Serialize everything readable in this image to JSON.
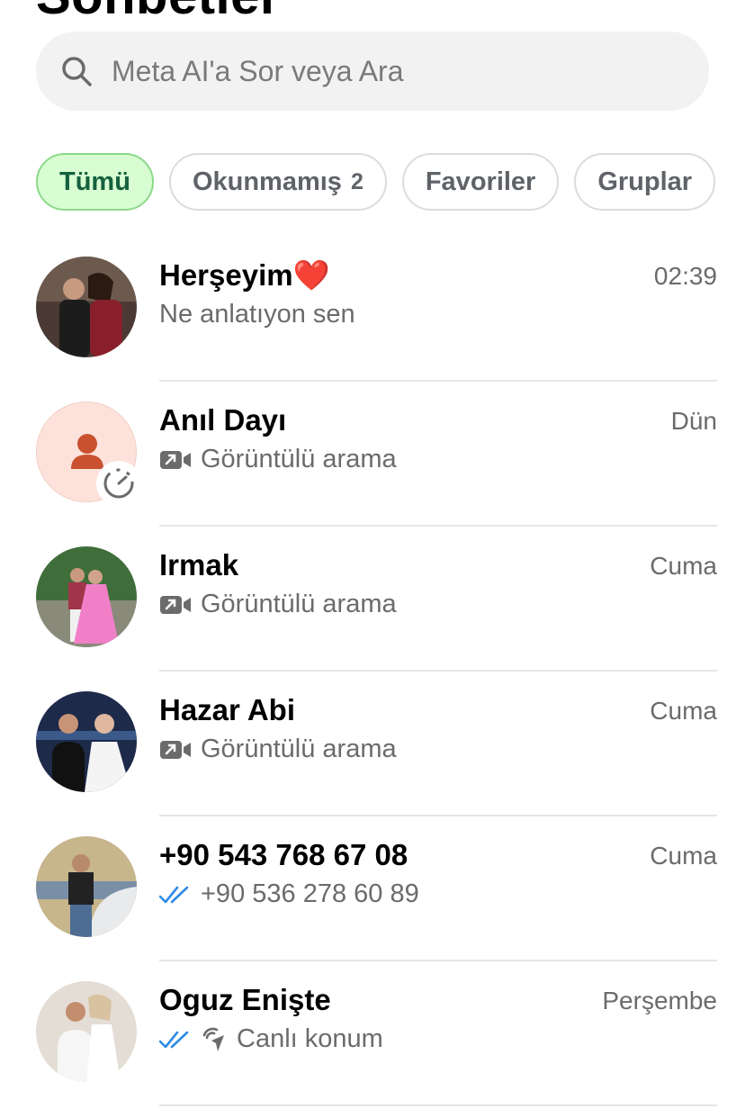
{
  "page": {
    "title": "Sohbetler"
  },
  "search": {
    "placeholder": "Meta AI'a Sor veya Ara"
  },
  "filters": [
    {
      "label": "Tümü",
      "count": "",
      "active": true
    },
    {
      "label": "Okunmamış",
      "count": "2",
      "active": false
    },
    {
      "label": "Favoriler",
      "count": "",
      "active": false
    },
    {
      "label": "Gruplar",
      "count": "",
      "active": false
    }
  ],
  "chats": [
    {
      "name": "Herşeyim❤️",
      "time": "02:39",
      "preview": "Ne anlatıyon sen",
      "preview_icon": ""
    },
    {
      "name": "Anıl Dayı",
      "time": "Dün",
      "preview": "Görüntülü arama",
      "preview_icon": "video-call-icon"
    },
    {
      "name": "Irmak",
      "time": "Cuma",
      "preview": "Görüntülü arama",
      "preview_icon": "video-call-icon"
    },
    {
      "name": "Hazar Abi",
      "time": "Cuma",
      "preview": "Görüntülü arama",
      "preview_icon": "video-call-icon"
    },
    {
      "name": "+90 543 768 67 08",
      "time": "Cuma",
      "preview": "+90 536 278 60 89",
      "preview_icon": "double-check-icon"
    },
    {
      "name": "Oguz Enişte",
      "time": "Perşembe",
      "preview": "Canlı konum",
      "preview_icon": "live-location-icon"
    }
  ],
  "colors": {
    "accent_green": "#15603e",
    "chip_active_bg": "#d8fdd2",
    "read_tick_blue": "#2f8be6",
    "muted_text": "#6b6b6b"
  }
}
